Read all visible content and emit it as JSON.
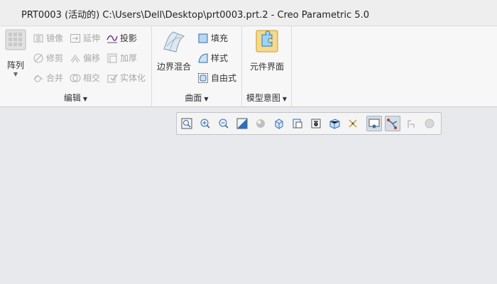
{
  "window": {
    "title": "PRT0003 (活动的) C:\\Users\\Dell\\Desktop\\prt0003.prt.2 - Creo Parametric 5.0"
  },
  "ribbon": {
    "edit_group": {
      "label": "编辑",
      "pattern": "阵列",
      "mirror": "镜像",
      "extend": "延伸",
      "project": "投影",
      "trim": "修剪",
      "offset": "偏移",
      "thicken": "加厚",
      "merge": "合并",
      "intersect": "相交",
      "solidify": "实体化"
    },
    "surface_group": {
      "label": "曲面",
      "boundary_blend": "边界混合",
      "fill": "填充",
      "style": "样式",
      "freestyle": "自由式"
    },
    "model_intent_group": {
      "label": "模型意图",
      "component_interface": "元件界面"
    }
  },
  "view_toolbar": {
    "icons": [
      "refit-icon",
      "zoom-in-icon",
      "zoom-out-icon",
      "repaint-icon",
      "display-style-icon",
      "saved-orientations-icon",
      "named-views-icon",
      "view-manager-icon",
      "perspective-icon",
      "datum-display-icon",
      "spin-center-icon",
      "annotation-display-icon",
      "plane-display-icon",
      "appearance-icon"
    ]
  },
  "colors": {
    "accent_blue": "#2f6db5",
    "disabled": "#a9a9a9",
    "purple": "#7a2fa0"
  }
}
